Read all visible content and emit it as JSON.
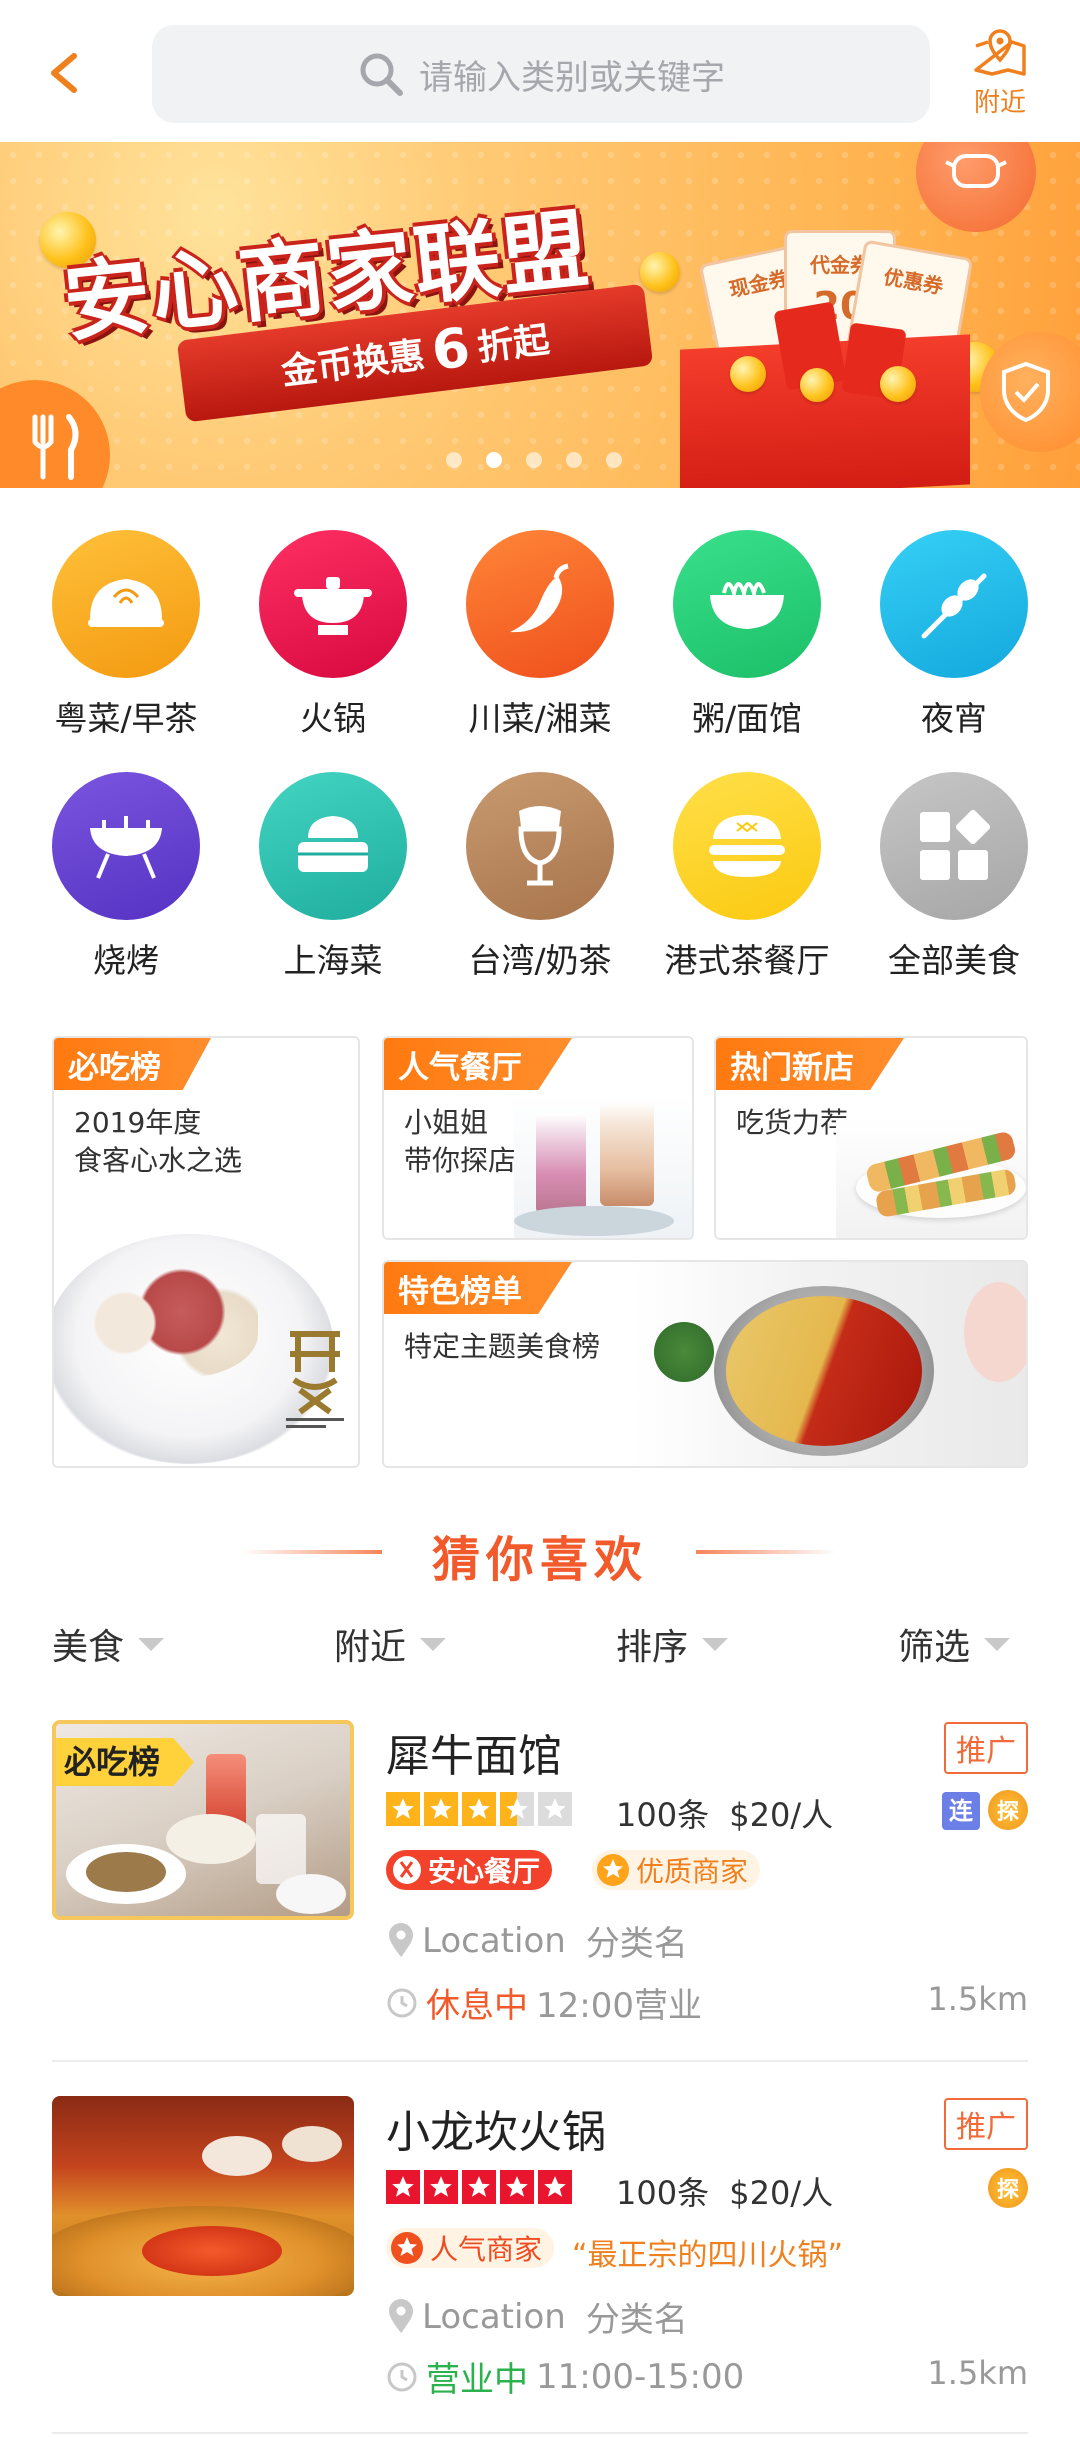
{
  "header": {
    "search_placeholder": "请输入类别或关键字",
    "nearby_label": "附近",
    "accent": "#f0801e"
  },
  "banner": {
    "title": "安心商家联盟",
    "ribbon_prefix": "金币换惠",
    "ribbon_number": "6",
    "ribbon_suffix": "折起",
    "coupon_labels": [
      "现金券",
      "代金券",
      "优惠券"
    ],
    "coupon_value": "20",
    "page_count": 5,
    "active_page": 2
  },
  "categories": [
    {
      "label": "粤菜/早茶",
      "icon": "bun-icon",
      "color": "#f8a21c"
    },
    {
      "label": "火锅",
      "icon": "hotpot-icon",
      "color": "#e8194f"
    },
    {
      "label": "川菜/湘菜",
      "icon": "chili-icon",
      "color": "#f7642a"
    },
    {
      "label": "粥/面馆",
      "icon": "noodle-bowl-icon",
      "color": "#27cf7a"
    },
    {
      "label": "夜宵",
      "icon": "skewer-icon",
      "color": "#22bde9"
    },
    {
      "label": "烧烤",
      "icon": "grill-icon",
      "color": "#6b45d3"
    },
    {
      "label": "上海菜",
      "icon": "steamer-icon",
      "color": "#2fc4b4"
    },
    {
      "label": "台湾/奶茶",
      "icon": "milk-tea-icon",
      "color": "#b9855a"
    },
    {
      "label": "港式茶餐厅",
      "icon": "burger-icon",
      "color": "#fdd22a"
    },
    {
      "label": "全部美食",
      "icon": "grid-icon",
      "color": "#b7b7b7"
    }
  ],
  "feature_cards": {
    "must_eat": {
      "tag": "必吃榜",
      "subtitle": "2019年度\n食客心水之选"
    },
    "popular": {
      "tag": "人气餐厅",
      "subtitle": "小姐姐\n带你探店"
    },
    "new_shops": {
      "tag": "热门新店",
      "subtitle": "吃货力荐"
    },
    "special": {
      "tag": "特色榜单",
      "subtitle": "特定主题美食榜"
    }
  },
  "guess": {
    "title": "猜你喜欢"
  },
  "filters": [
    "美食",
    "附近",
    "排序",
    "筛选"
  ],
  "shops": [
    {
      "name": "犀牛面馆",
      "promo": "推广",
      "rating": 3.5,
      "reviews": "100条",
      "price": "$20/人",
      "chain_badge": "连",
      "explore_badge": "探",
      "image_tag": "必吃榜",
      "tag_safe": "安心餐厅",
      "tag_quality": "优质商家",
      "location": "Location",
      "category": "分类名",
      "status": "休息中",
      "status_color": "#f25a2a",
      "hours": "12:00营业",
      "distance": "1.5km"
    },
    {
      "name": "小龙坎火锅",
      "promo": "推广",
      "rating": 5,
      "reviews": "100条",
      "price": "$20/人",
      "explore_badge": "探",
      "tag_popular": "人气商家",
      "quote": "“最正宗的四川火锅”",
      "location": "Location",
      "category": "分类名",
      "status": "营业中",
      "status_color": "#2bb24c",
      "hours": "11:00-15:00",
      "distance": "1.5km"
    }
  ]
}
